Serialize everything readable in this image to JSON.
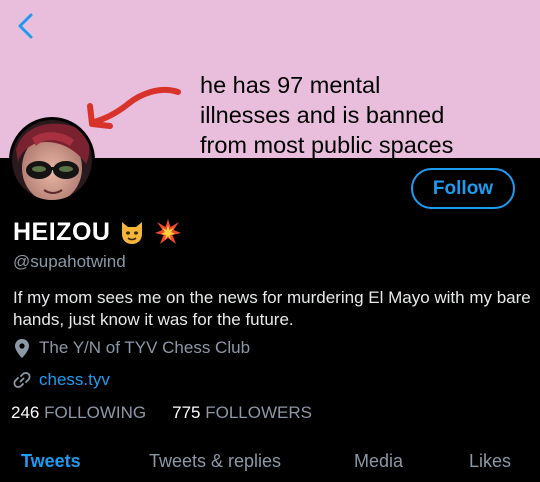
{
  "banner": {
    "text": "he has 97 mental\nillnesses and is banned\nfrom most public spaces",
    "background": "#e9bedc"
  },
  "nav": {
    "back_icon": "chevron-left-icon"
  },
  "profile": {
    "display_name": "HEIZOU",
    "emojis": [
      "cat-face-emoji",
      "collision-emoji"
    ],
    "handle": "@supahotwind",
    "bio": "If my mom sees me on the news for murdering El Mayo with my bare hands, just know it was for the future.",
    "location": "The Y/N of TYV Chess Club",
    "link": "chess.tyv",
    "follow_label": "Follow"
  },
  "stats": {
    "following_count": "246",
    "following_label": "FOLLOWING",
    "followers_count": "775",
    "followers_label": "FOLLOWERS"
  },
  "tabs": [
    {
      "label": "Tweets",
      "active": true
    },
    {
      "label": "Tweets & replies",
      "active": false
    },
    {
      "label": "Media",
      "active": false
    },
    {
      "label": "Likes",
      "active": false
    }
  ],
  "colors": {
    "accent": "#1d9bf0",
    "muted": "#8b98a5",
    "background": "#000000"
  }
}
